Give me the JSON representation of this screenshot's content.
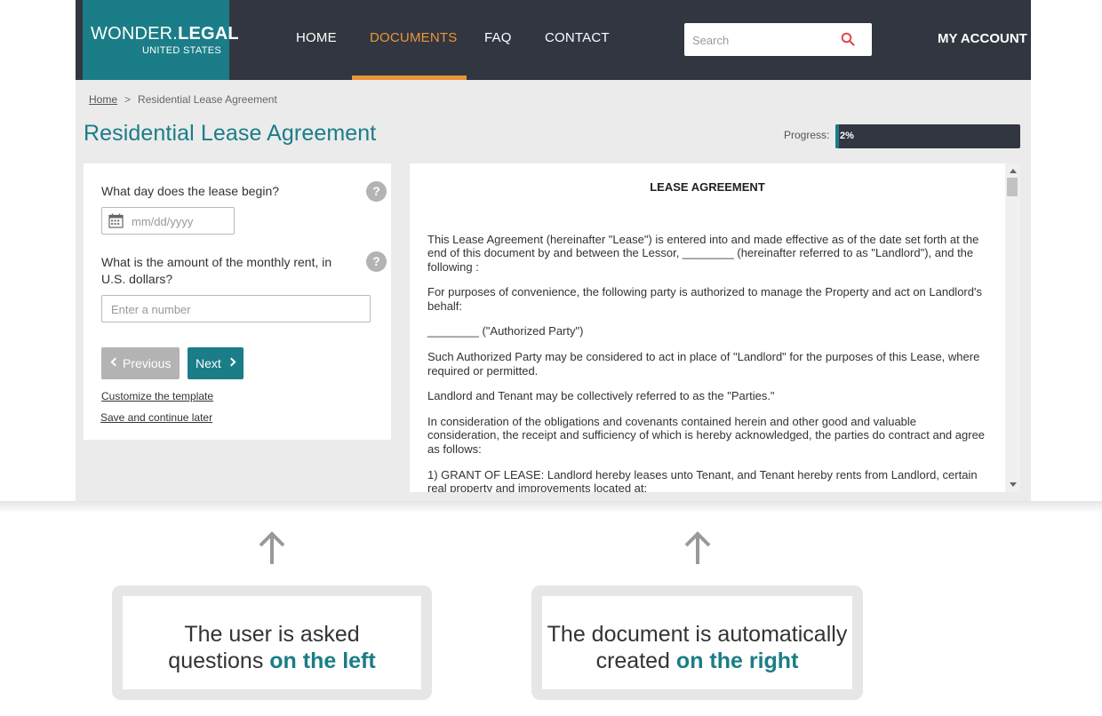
{
  "logo": {
    "brand_light": "WONDER.",
    "brand_bold": "LEGAL",
    "subtitle": "UNITED STATES"
  },
  "nav": {
    "items": [
      {
        "label": "HOME"
      },
      {
        "label": "DOCUMENTS",
        "active": true
      },
      {
        "label": "FAQ"
      },
      {
        "label": "CONTACT"
      }
    ],
    "search_placeholder": "Search",
    "account_label": "MY ACCOUNT"
  },
  "breadcrumb": {
    "home": "Home",
    "separator": ">",
    "current": "Residential Lease Agreement"
  },
  "page_title": "Residential Lease Agreement",
  "progress": {
    "label": "Progress:",
    "text": "2%",
    "value": 0.02
  },
  "questions": {
    "q1_label": "What day does the lease begin?",
    "q1_placeholder": "mm/dd/yyyy",
    "q2_label": "What is the amount of the monthly rent, in U.S. dollars?",
    "q2_placeholder": "Enter a number",
    "help_symbol": "?",
    "previous_label": "Previous",
    "next_label": "Next",
    "customize_link": "Customize the template",
    "save_link": "Save and continue later"
  },
  "document": {
    "title": "LEASE AGREEMENT",
    "paragraphs": [
      "This Lease Agreement (hereinafter \"Lease\") is entered into and made effective as of the date set forth at the end of this document by and between the Lessor, ________ (hereinafter referred to as \"Landlord\"), and the following :",
      "For purposes of convenience, the following party is authorized to manage the Property and act on Landlord's behalf:",
      "________ (\"Authorized Party\")",
      "Such Authorized Party may be considered to act in place of \"Landlord\" for the purposes of this Lease, where required or permitted.",
      "Landlord and Tenant may be collectively referred to as the \"Parties.\"",
      "In consideration of the obligations and covenants contained herein and other good and valuable consideration, the receipt and sufficiency of which is hereby acknowledged, the parties do contract and agree as follows:",
      "1) GRANT OF LEASE: Landlord hereby leases unto Tenant, and Tenant hereby rents from Landlord, certain real property and improvements located at:"
    ]
  },
  "callouts": {
    "left": {
      "line1": "The user is asked",
      "line2_plain": "questions ",
      "line2_highlight": "on the left"
    },
    "right": {
      "line1": "The document is automatically",
      "line2_plain": "created ",
      "line2_highlight": "on the right"
    }
  },
  "colors": {
    "teal": "#1a7d87",
    "orange": "#e8963a",
    "navbar": "#323640",
    "grey": "#b3b3b3"
  }
}
